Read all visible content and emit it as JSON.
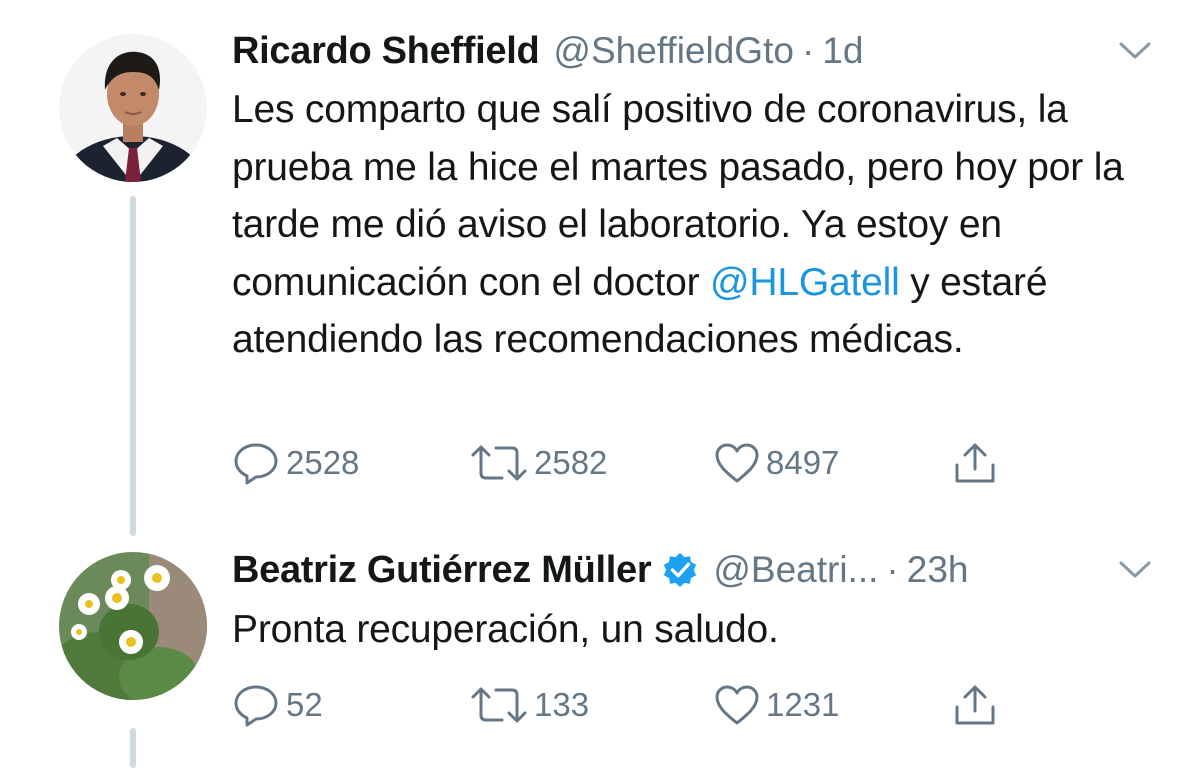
{
  "tweets": [
    {
      "author_name": "Ricardo Sheffield",
      "handle": "@SheffieldGto",
      "separator": "·",
      "time": "1d",
      "text_before": "Les comparto que salí positivo de coronavirus, la prueba me la hice el martes pasado, pero hoy por la tarde me dió aviso el laboratorio. Ya estoy en comunicación con el doctor ",
      "mention": "@HLGatell",
      "text_after": " y estaré atendiendo las recomendaciones médicas.",
      "replies": "2528",
      "retweets": "2582",
      "likes": "8497",
      "avatar_icon": "man-in-suit-avatar",
      "verified": false
    },
    {
      "author_name": "Beatriz Gutiérrez Müller",
      "handle": "@Beatri...",
      "separator": "·",
      "time": "23h",
      "text": "Pronta recuperación, un saludo.",
      "replies": "52",
      "retweets": "133",
      "likes": "1231",
      "avatar_icon": "daisy-flowers-avatar",
      "verified": true
    }
  ],
  "colors": {
    "text": "#14171a",
    "secondary": "#657786",
    "link": "#1b95e0",
    "verified": "#1da1f2",
    "thread_line": "#cfd9de"
  },
  "icons": [
    "reply-icon",
    "retweet-icon",
    "like-icon",
    "share-icon",
    "chevron-down-icon",
    "verified-badge-icon"
  ]
}
